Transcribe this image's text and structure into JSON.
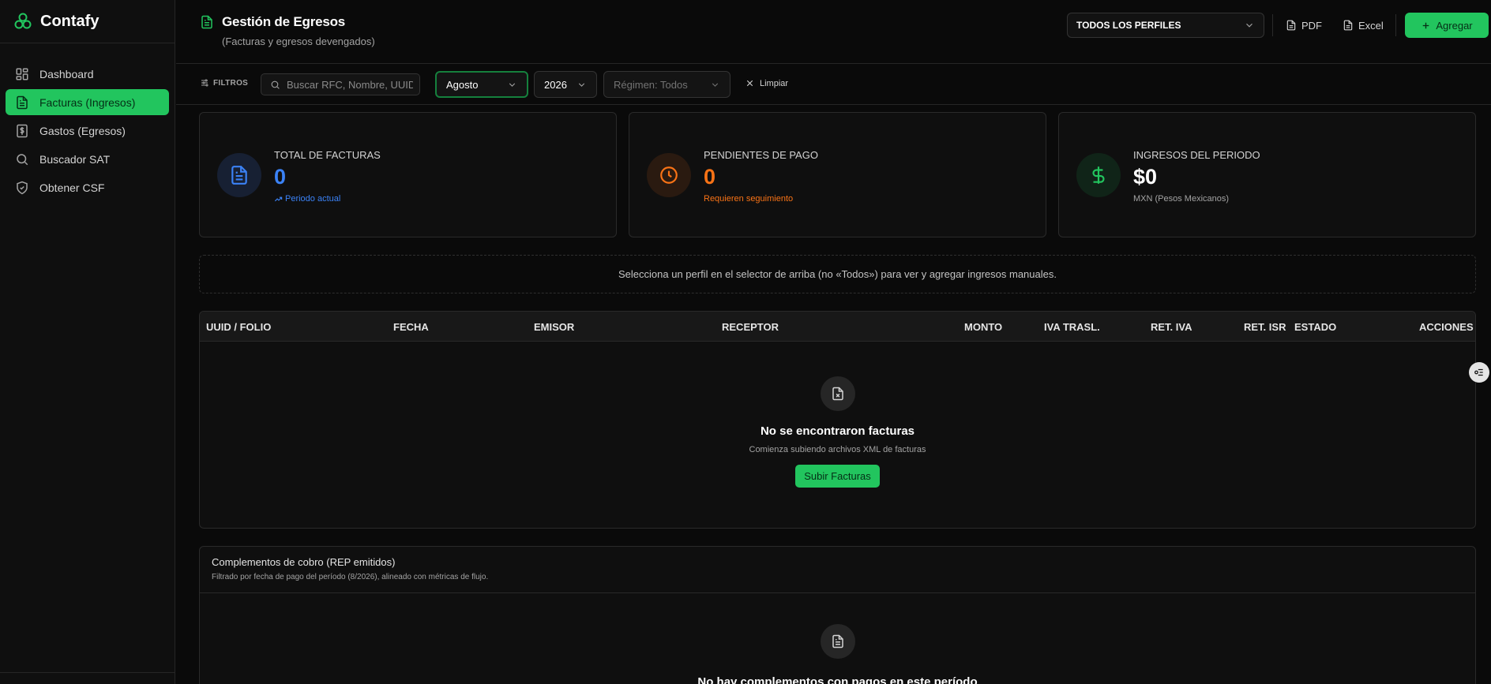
{
  "app": {
    "name": "Contafy"
  },
  "sidebar": {
    "items": [
      {
        "label": "Dashboard",
        "icon": "grid-icon",
        "active": false
      },
      {
        "label": "Facturas (Ingresos)",
        "icon": "document-icon",
        "active": true
      },
      {
        "label": "Gastos (Egresos)",
        "icon": "dollar-receipt-icon",
        "active": false
      },
      {
        "label": "Buscador SAT",
        "icon": "search-icon",
        "active": false
      },
      {
        "label": "Obtener CSF",
        "icon": "shield-icon",
        "active": false
      }
    ]
  },
  "header": {
    "title": "Gestión de Egresos",
    "subtitle": "(Facturas y egresos devengados)",
    "profile_select": "TODOS LOS PERFILES",
    "pdf_label": "PDF",
    "excel_label": "Excel",
    "add_label": "Agregar"
  },
  "filters": {
    "label": "FILTROS",
    "search_placeholder": "Buscar RFC, Nombre, UUID",
    "month": "Agosto",
    "year": "2026",
    "regimen": "Régimen: Todos",
    "clear_label": "Limpiar"
  },
  "stats": [
    {
      "label": "TOTAL DE FACTURAS",
      "value": "0",
      "note": "Periodo actual",
      "color": "#3b82f6"
    },
    {
      "label": "PENDIENTES DE PAGO",
      "value": "0",
      "note": "Requieren seguimiento",
      "color": "#f97316"
    },
    {
      "label": "INGRESOS DEL PERIODO",
      "value": "$0",
      "note": "MXN (Pesos Mexicanos)",
      "color": "#22c55e"
    }
  ],
  "notice": "Selecciona un perfil en el selector de arriba (no «Todos») para ver y agregar ingresos manuales.",
  "table": {
    "columns": [
      "UUID / FOLIO",
      "FECHA",
      "EMISOR",
      "RECEPTOR",
      "MONTO",
      "IVA TRASL.",
      "RET. IVA",
      "RET. ISR",
      "ESTADO",
      "ACCIONES"
    ],
    "empty_title": "No se encontraron facturas",
    "empty_subtitle": "Comienza subiendo archivos XML de facturas",
    "upload_label": "Subir Facturas"
  },
  "complementos": {
    "title": "Complementos de cobro (REP emitidos)",
    "subtitle": "Filtrado por fecha de pago del período (8/2026), alineado con métricas de flujo.",
    "empty_title": "No hay complementos con pagos en este período"
  },
  "colors": {
    "accent": "#22c55e",
    "background": "#0a0a0a"
  }
}
